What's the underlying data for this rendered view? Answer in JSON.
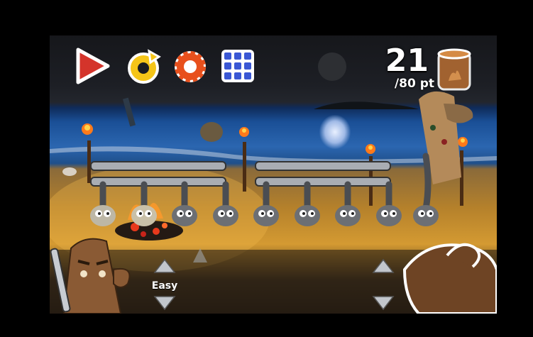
{
  "score": "21",
  "target": "/80 pt",
  "difficulty": "Easy",
  "icons": {
    "play": "play-icon",
    "reload": "reload-icon",
    "settings": "gear-icon",
    "menu": "grid-icon",
    "bucket": "bucket-icon"
  },
  "colors": {
    "play": "#d4342b",
    "reload": "#f5c518",
    "gear": "#e8501c",
    "grid": "#3a57d4",
    "sand": "#d49a32",
    "sea": "#1a4f96"
  }
}
